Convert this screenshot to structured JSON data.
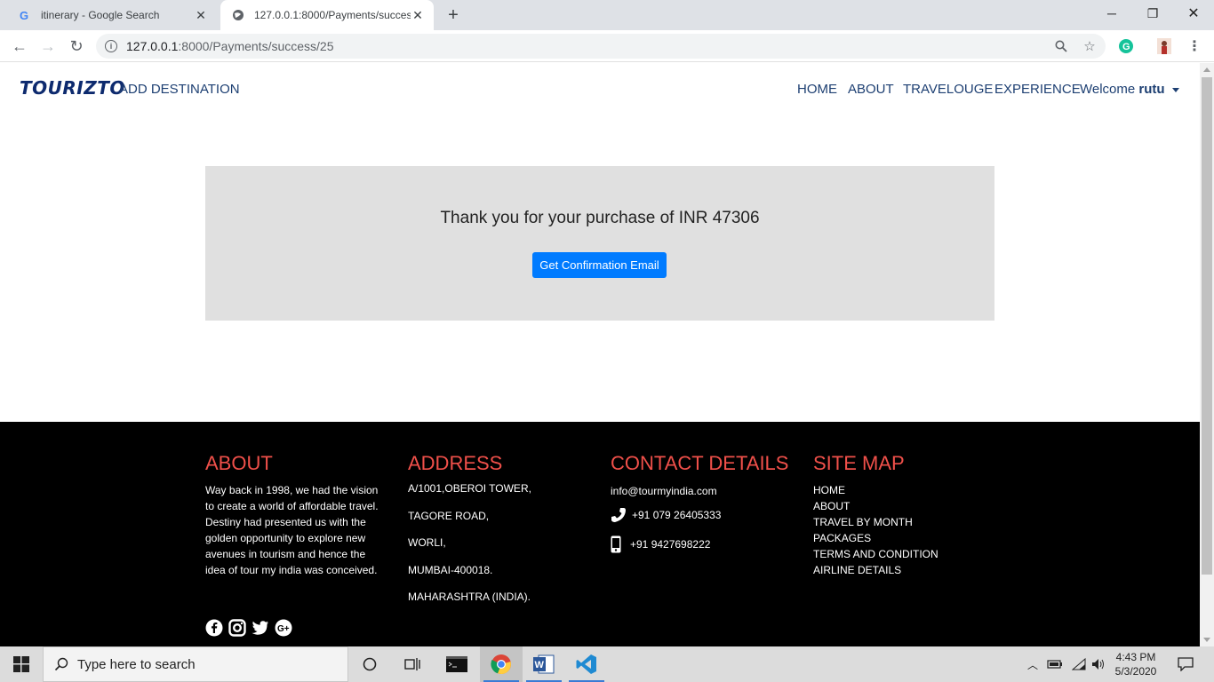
{
  "browser": {
    "tabs": [
      {
        "title": "itinerary - Google Search",
        "favicon": "google-icon"
      },
      {
        "title": "127.0.0.1:8000/Payments/success/25",
        "favicon": "globe-icon"
      }
    ],
    "url_host": "127.0.0.1",
    "url_rest": ":8000/Payments/success/25"
  },
  "navbar": {
    "brand": "TOURIZTO",
    "add_destination": "ADD DESTINATION",
    "links": [
      "HOME",
      "ABOUT",
      "TRAVELOUGE",
      "EXPERIENCE"
    ],
    "welcome_prefix": "Welcome",
    "username": "rutu"
  },
  "main": {
    "message": "Thank you for your purchase of INR 47306",
    "button_label": "Get Confirmation Email"
  },
  "footer": {
    "about": {
      "heading": "ABOUT",
      "text": "Way back in 1998, we had the vision to create a world of affordable travel. Destiny had presented us with the golden opportunity to explore new avenues in tourism and hence the idea of tour my india was conceived."
    },
    "address": {
      "heading": "ADDRESS",
      "lines": [
        "A/1001,OBEROI TOWER,",
        "TAGORE ROAD,",
        "WORLI,",
        "MUMBAI-400018.",
        "MAHARASHTRA (INDIA)."
      ]
    },
    "contact": {
      "heading": "CONTACT DETAILS",
      "email": "info@tourmyindia.com",
      "phone": "+91 079 26405333",
      "mobile": "+91 9427698222"
    },
    "sitemap": {
      "heading": "SITE MAP",
      "items": [
        "HOME",
        "ABOUT",
        "TRAVEL BY MONTH",
        "PACKAGES",
        "TERMS AND CONDITION",
        "AIRLINE DETAILS"
      ]
    },
    "socials": [
      "facebook-icon",
      "instagram-icon",
      "twitter-icon",
      "google-plus-icon"
    ]
  },
  "taskbar": {
    "search_placeholder": "Type here to search",
    "time": "4:43 PM",
    "date": "5/3/2020"
  },
  "colors": {
    "brand": "#0d2a6e",
    "nav_link": "#1d3f72",
    "button": "#007bff",
    "footer_heading": "#f0504a",
    "jumbotron_bg": "#e0e0e0"
  }
}
